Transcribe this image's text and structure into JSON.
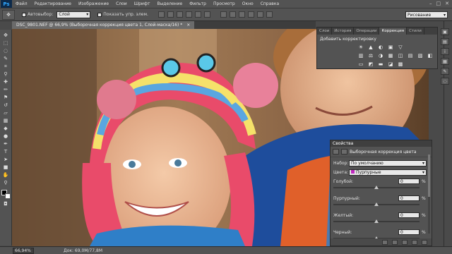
{
  "app": {
    "logo": "Ps"
  },
  "menu": [
    "Файл",
    "Редактирование",
    "Изображение",
    "Слои",
    "Шрифт",
    "Выделение",
    "Фильтр",
    "Просмотр",
    "Окно",
    "Справка"
  ],
  "options": {
    "auto_select_label": "Автовыбор:",
    "auto_select_value": "Слой",
    "show_controls_label": "Показать упр. элем.",
    "workspace": "Рисование"
  },
  "document": {
    "tab_title": "DSC_9801.NEF @ 66,9% (Выборочная коррекция цвета 1, Слой-маска/16) *",
    "close": "×"
  },
  "status": {
    "zoom": "66,94%",
    "doc_size": "Док: 69,0M/77,8M"
  },
  "adjustments": {
    "tabs": [
      "Слои",
      "История",
      "Операции",
      "Коррекция",
      "Стили"
    ],
    "active_tab": "Коррекция",
    "title": "Добавить корректировку",
    "icons_row1": [
      "☀",
      "▲",
      "◐",
      "▣",
      "▽"
    ],
    "icons_row2": [
      "▥",
      "⚖",
      "◑",
      "▦",
      "◫",
      "▤",
      "▧",
      "◧"
    ],
    "icons_row3": [
      "▭",
      "◩",
      "▬",
      "◪",
      "▩"
    ]
  },
  "properties": {
    "header": "Свойства",
    "subtitle": "Выборочная коррекция цвета",
    "preset_label": "Набор:",
    "preset_value": "По умолчанию",
    "colors_label": "Цвета:",
    "colors_value": "Пурпурные",
    "sliders": [
      {
        "label": "Голубой:",
        "value": "0",
        "unit": "%",
        "level": 0.5
      },
      {
        "label": "Пурпурный:",
        "value": "0",
        "unit": "%",
        "level": 0.5
      },
      {
        "label": "Желтый:",
        "value": "0",
        "unit": "%",
        "level": 0.5
      },
      {
        "label": "Черный:",
        "value": "0",
        "unit": "%",
        "level": 0.5
      }
    ]
  },
  "colors": {
    "panel": "#535353",
    "menubar": "#535353",
    "accent_magenta": "#c02ac0"
  }
}
